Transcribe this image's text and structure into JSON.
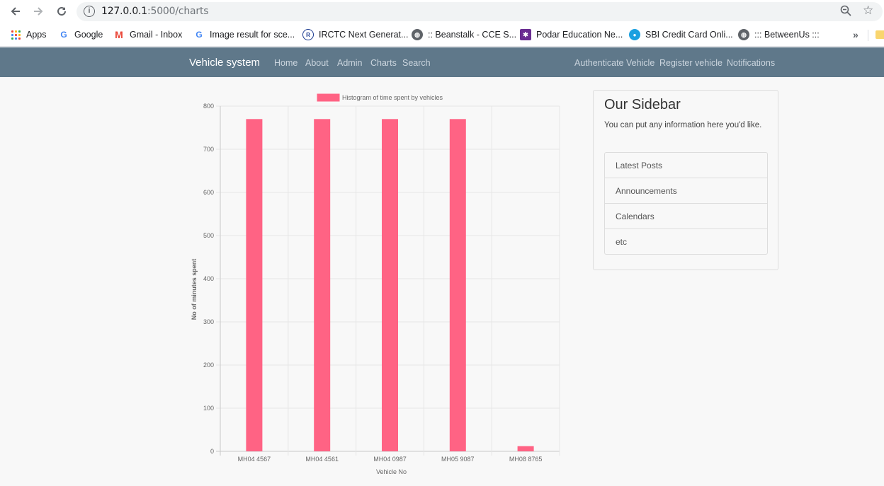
{
  "browser": {
    "url_host": "127.0.0.1",
    "url_path": ":5000/charts",
    "bookmarks": [
      {
        "label": "Apps",
        "icon": "apps-grid-icon"
      },
      {
        "label": "Google",
        "icon": "google-icon"
      },
      {
        "label": "Gmail - Inbox",
        "icon": "gmail-icon"
      },
      {
        "label": "Image result for sce...",
        "icon": "google-icon"
      },
      {
        "label": "IRCTC Next Generat...",
        "icon": "irctc-icon"
      },
      {
        "label": ":: Beanstalk - CCE S...",
        "icon": "globe-icon"
      },
      {
        "label": "Podar Education Ne...",
        "icon": "podar-icon"
      },
      {
        "label": "SBI Credit Card Onli...",
        "icon": "sbi-icon"
      },
      {
        "label": "::: BetweenUs :::",
        "icon": "globe-icon"
      }
    ],
    "more": "»"
  },
  "navbar": {
    "brand": "Vehicle system",
    "left_links": [
      "Home",
      "About",
      "Admin",
      "Charts",
      "Search"
    ],
    "right_links": [
      "Authenticate Vehicle",
      "Register vehicle",
      "Notifications"
    ],
    "background": "#5f788a"
  },
  "chart_data": {
    "type": "bar",
    "legend": "Histogram of time spent by vehicles",
    "categories": [
      "MH04 4567",
      "MH04 4561",
      "MH04 0987",
      "MH05 9087",
      "MH08 8765"
    ],
    "values": [
      770,
      770,
      770,
      770,
      12
    ],
    "xlabel": "Vehicle No",
    "ylabel": "No of minutes spent",
    "ylim": [
      0,
      800
    ],
    "yticks": [
      0,
      100,
      200,
      300,
      400,
      500,
      600,
      700,
      800
    ],
    "bar_color": "#ff6384",
    "grid": true,
    "legend_position": "top"
  },
  "sidebar": {
    "title": "Our Sidebar",
    "text": "You can put any information here you'd like.",
    "items": [
      "Latest Posts",
      "Announcements",
      "Calendars",
      "etc"
    ]
  }
}
